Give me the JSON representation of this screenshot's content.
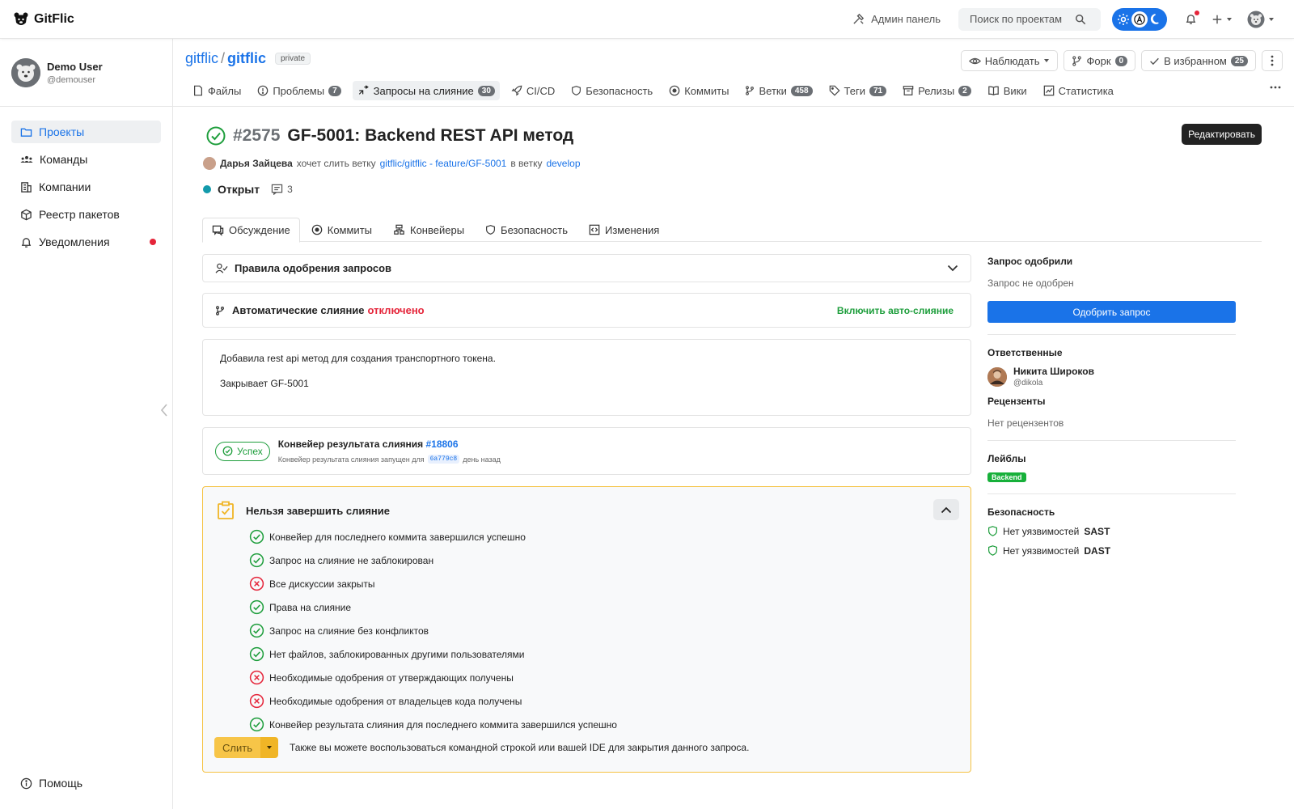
{
  "app": {
    "name": "GitFlic"
  },
  "topbar": {
    "admin_label": "Админ панель",
    "search_placeholder": "Поиск по проектам"
  },
  "user": {
    "name": "Demo User",
    "login": "@demouser"
  },
  "sidebar": {
    "items": [
      {
        "label": "Проекты",
        "icon": "folder-icon",
        "active": true
      },
      {
        "label": "Команды",
        "icon": "team-icon"
      },
      {
        "label": "Компании",
        "icon": "building-icon"
      },
      {
        "label": "Реестр пакетов",
        "icon": "package-icon"
      },
      {
        "label": "Уведомления",
        "icon": "bell-icon",
        "has_dot": true
      }
    ],
    "help_label": "Помощь"
  },
  "repo": {
    "owner": "gitflic",
    "separator": "/",
    "name": "gitflic",
    "visibility": "private",
    "watch_label": "Наблюдать",
    "fork_label": "Форк",
    "fork_count": "0",
    "star_label": "В избранном",
    "star_count": "25",
    "tabs": [
      {
        "label": "Файлы",
        "icon": "file-icon"
      },
      {
        "label": "Проблемы",
        "icon": "issue-icon",
        "count": "7"
      },
      {
        "label": "Запросы на слияние",
        "icon": "merge-request-icon",
        "count": "30",
        "active": true
      },
      {
        "label": "CI/CD",
        "icon": "rocket-icon"
      },
      {
        "label": "Безопасность",
        "icon": "shield-icon"
      },
      {
        "label": "Коммиты",
        "icon": "commit-icon"
      },
      {
        "label": "Ветки",
        "icon": "branch-icon",
        "count": "458"
      },
      {
        "label": "Теги",
        "icon": "tag-icon",
        "count": "71"
      },
      {
        "label": "Релизы",
        "icon": "archive-icon",
        "count": "2"
      },
      {
        "label": "Вики",
        "icon": "book-icon"
      },
      {
        "label": "Статистика",
        "icon": "chart-icon"
      }
    ]
  },
  "mr": {
    "number": "#2575",
    "title": "GF-5001: Backend REST API метод",
    "edit_label": "Редактировать",
    "author": "Дарья Зайцева",
    "wants_text": "хочет слить ветку",
    "source_branch": "gitflic/gitflic - feature/GF-5001",
    "into_text": "в ветку",
    "target_branch": "develop",
    "status": "Открыт",
    "comments_count": "3",
    "tabs": [
      {
        "label": "Обсуждение",
        "icon": "discussion-icon",
        "active": true
      },
      {
        "label": "Коммиты",
        "icon": "commit-icon"
      },
      {
        "label": "Конвейеры",
        "icon": "pipeline-icon"
      },
      {
        "label": "Безопасность",
        "icon": "shield-icon"
      },
      {
        "label": "Изменения",
        "icon": "code-icon"
      }
    ],
    "approval_rules_label": "Правила одобрения запросов",
    "automerge_label": "Автоматические слияние",
    "automerge_state": "отключено",
    "enable_automerge_label": "Включить авто-слияние",
    "description": [
      "Добавила rest api метод для создания транспортного токена.",
      "Закрывает GF-5001"
    ],
    "pipeline": {
      "status": "Успех",
      "title": "Конвейер результата слияния",
      "id": "#18806",
      "sub_prefix": "Конвейер результата слияния запущен для",
      "commit": "6a779c8",
      "sub_suffix": "день назад"
    },
    "merge_checks": {
      "title": "Нельзя завершить слияние",
      "items": [
        {
          "text": "Конвейер для последнего коммита завершился успешно",
          "ok": true
        },
        {
          "text": "Запрос на слияние не заблокирован",
          "ok": true
        },
        {
          "text": "Все дискуссии закрыты",
          "ok": false
        },
        {
          "text": "Права на слияние",
          "ok": true
        },
        {
          "text": "Запрос на слияние без конфликтов",
          "ok": true
        },
        {
          "text": "Нет файлов, заблокированных другими пользователями",
          "ok": true
        },
        {
          "text": "Необходимые одобрения от утверждающих получены",
          "ok": false
        },
        {
          "text": "Необходимые одобрения от владельцев кода получены",
          "ok": false
        },
        {
          "text": "Конвейер результата слияния для последнего коммита завершился успешно",
          "ok": true
        }
      ],
      "merge_label": "Слить",
      "hint": "Также вы можете воспользоваться командной строкой или вашей IDE для закрытия данного запроса."
    }
  },
  "side": {
    "approved_title": "Запрос одобрили",
    "approved_state": "Запрос не одобрен",
    "approve_label": "Одобрить запрос",
    "assignees_title": "Ответственные",
    "assignee_name": "Никита Широков",
    "assignee_login": "@dikola",
    "reviewers_title": "Рецензенты",
    "reviewers_state": "Нет рецензентов",
    "labels_title": "Лейблы",
    "label": "Backend",
    "security_title": "Безопасность",
    "security_items": [
      {
        "prefix": "Нет уязвимостей",
        "kind": "SAST"
      },
      {
        "prefix": "Нет уязвимостей",
        "kind": "DAST"
      }
    ]
  },
  "colors": {
    "accent": "#1a73e8",
    "success": "#1e9e3c",
    "danger": "#e5253a",
    "warning": "#f5c242",
    "label": "#17b03a"
  }
}
